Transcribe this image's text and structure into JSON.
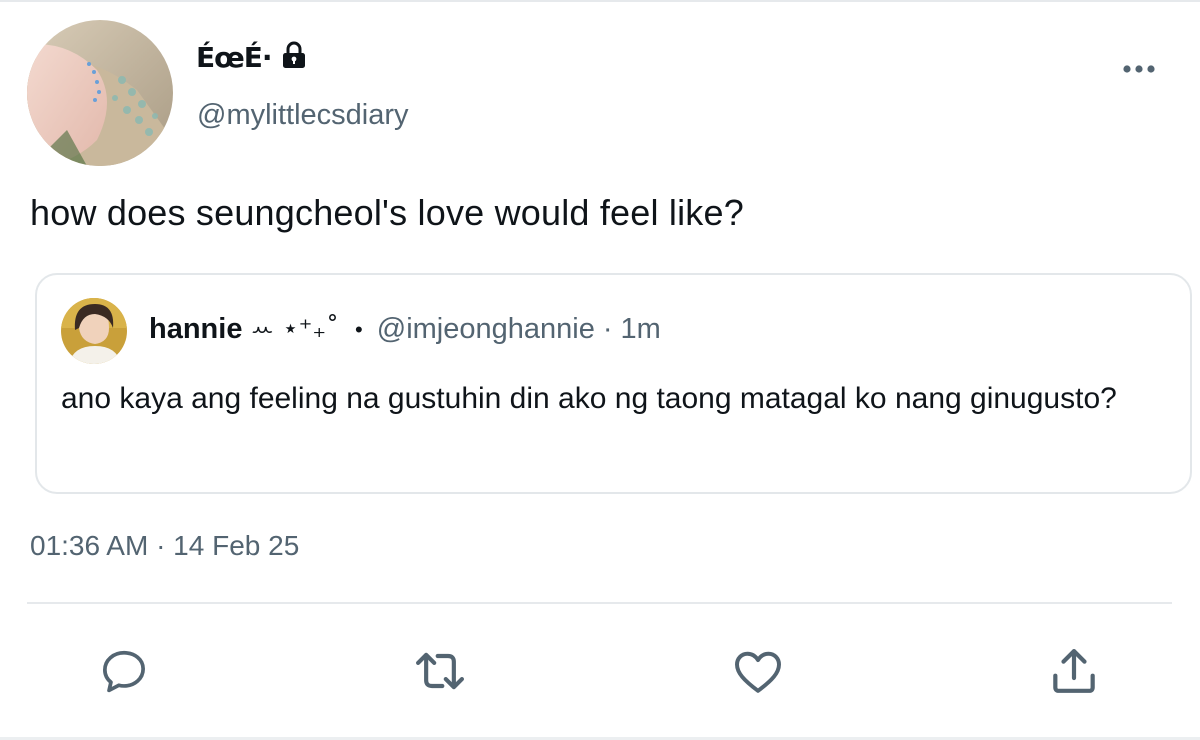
{
  "author": {
    "display_name": "ÉœÉ·",
    "handle": "@mylittlecsdiary",
    "protected_icon": "lock-icon"
  },
  "tweet": {
    "text": "how does seungcheol's love would feel like?"
  },
  "quote": {
    "name": "hannie",
    "decoration": "ꕀ ⋆⁺₊˚",
    "bullet": "•",
    "handle": "@imjeonghannie",
    "separator": "·",
    "time": "1m",
    "text": "ano kaya ang feeling na gustuhin din ako ng taong matagal ko nang ginugusto?"
  },
  "timestamp": "01:36 AM · 14 Feb 25",
  "actions": {
    "reply_icon": "reply-icon",
    "retweet_icon": "retweet-icon",
    "like_icon": "heart-icon",
    "share_icon": "share-icon"
  },
  "colors": {
    "primary_text": "#0f1419",
    "secondary_text": "#536471",
    "border": "#e3e7ea"
  }
}
